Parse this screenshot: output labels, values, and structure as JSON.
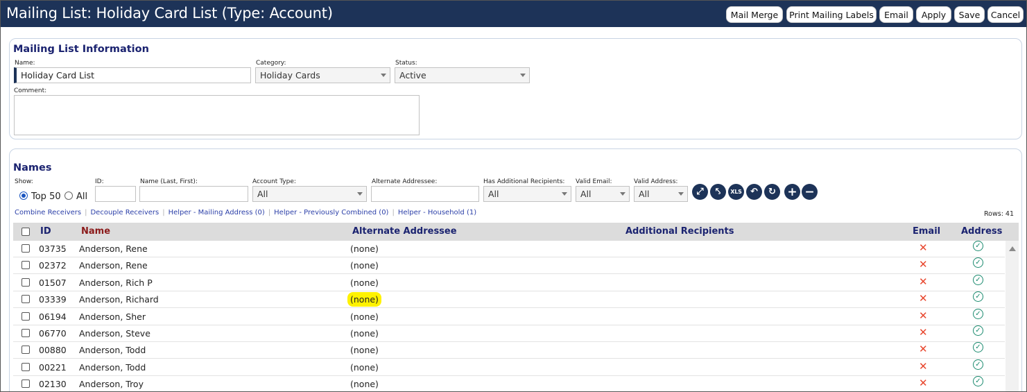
{
  "window": {
    "title": "Mailing List: Holiday Card List (Type: Account)"
  },
  "toolbar": {
    "mail_merge": "Mail Merge",
    "print_labels": "Print Mailing Labels",
    "email": "Email",
    "apply": "Apply",
    "save": "Save",
    "cancel": "Cancel"
  },
  "info": {
    "section_title": "Mailing List Information",
    "name_label": "Name:",
    "name_value": "Holiday Card List",
    "category_label": "Category:",
    "category_value": "Holiday Cards",
    "status_label": "Status:",
    "status_value": "Active",
    "comment_label": "Comment:",
    "comment_value": ""
  },
  "names": {
    "section_title": "Names",
    "filters": {
      "show_label": "Show:",
      "show_top50": "Top 50",
      "show_all": "All",
      "show_selected": "Top 50",
      "id_label": "ID:",
      "id_value": "",
      "name_label": "Name (Last, First):",
      "name_value": "",
      "account_type_label": "Account Type:",
      "account_type_value": "All",
      "alt_addressee_label": "Alternate Addressee:",
      "alt_addressee_value": "",
      "has_additional_label": "Has Additional Recipients:",
      "has_additional_value": "All",
      "valid_email_label": "Valid Email:",
      "valid_email_value": "All",
      "valid_address_label": "Valid Address:",
      "valid_address_value": "All"
    },
    "tool_icons": [
      "expand-icon",
      "collapse-icon",
      "xls-export-icon",
      "undo-icon",
      "refresh-icon",
      "add-icon",
      "remove-icon"
    ],
    "xls_text": "XLS",
    "links": [
      "Combine Receivers",
      "Decouple Receivers",
      "Helper - Mailing Address (0)",
      "Helper - Previously Combined (0)",
      "Helper - Household (1)"
    ],
    "rows_count": "Rows: 41",
    "columns": {
      "id": "ID",
      "name": "Name",
      "alternate_addressee": "Alternate Addressee",
      "additional_recipients": "Additional Recipients",
      "email": "Email",
      "address": "Address"
    },
    "rows": [
      {
        "id": "03735",
        "name": "Anderson, Rene",
        "alt": "(none)",
        "email_valid": false,
        "address_valid": true,
        "highlight": false
      },
      {
        "id": "02372",
        "name": "Anderson, Rene",
        "alt": "(none)",
        "email_valid": false,
        "address_valid": true,
        "highlight": false
      },
      {
        "id": "01507",
        "name": "Anderson, Rich P",
        "alt": "(none)",
        "email_valid": false,
        "address_valid": true,
        "highlight": false
      },
      {
        "id": "03339",
        "name": "Anderson, Richard",
        "alt": "(none)",
        "email_valid": false,
        "address_valid": true,
        "highlight": true
      },
      {
        "id": "06194",
        "name": "Anderson, Sher",
        "alt": "(none)",
        "email_valid": false,
        "address_valid": true,
        "highlight": false
      },
      {
        "id": "06770",
        "name": "Anderson, Steve",
        "alt": "(none)",
        "email_valid": false,
        "address_valid": true,
        "highlight": false
      },
      {
        "id": "00880",
        "name": "Anderson, Todd",
        "alt": "(none)",
        "email_valid": false,
        "address_valid": true,
        "highlight": false
      },
      {
        "id": "00221",
        "name": "Anderson, Todd",
        "alt": "(none)",
        "email_valid": false,
        "address_valid": true,
        "highlight": false
      },
      {
        "id": "02130",
        "name": "Anderson, Troy",
        "alt": "(none)",
        "email_valid": false,
        "address_valid": true,
        "highlight": false
      }
    ]
  },
  "colors": {
    "header_bg": "#1d3358",
    "section_title": "#1b2370",
    "name_header": "#8b1a1a",
    "invalid_mark": "#e8452c",
    "valid_mark": "#1a8a6e",
    "highlight": "#fff200",
    "link": "#2b3fa8"
  }
}
